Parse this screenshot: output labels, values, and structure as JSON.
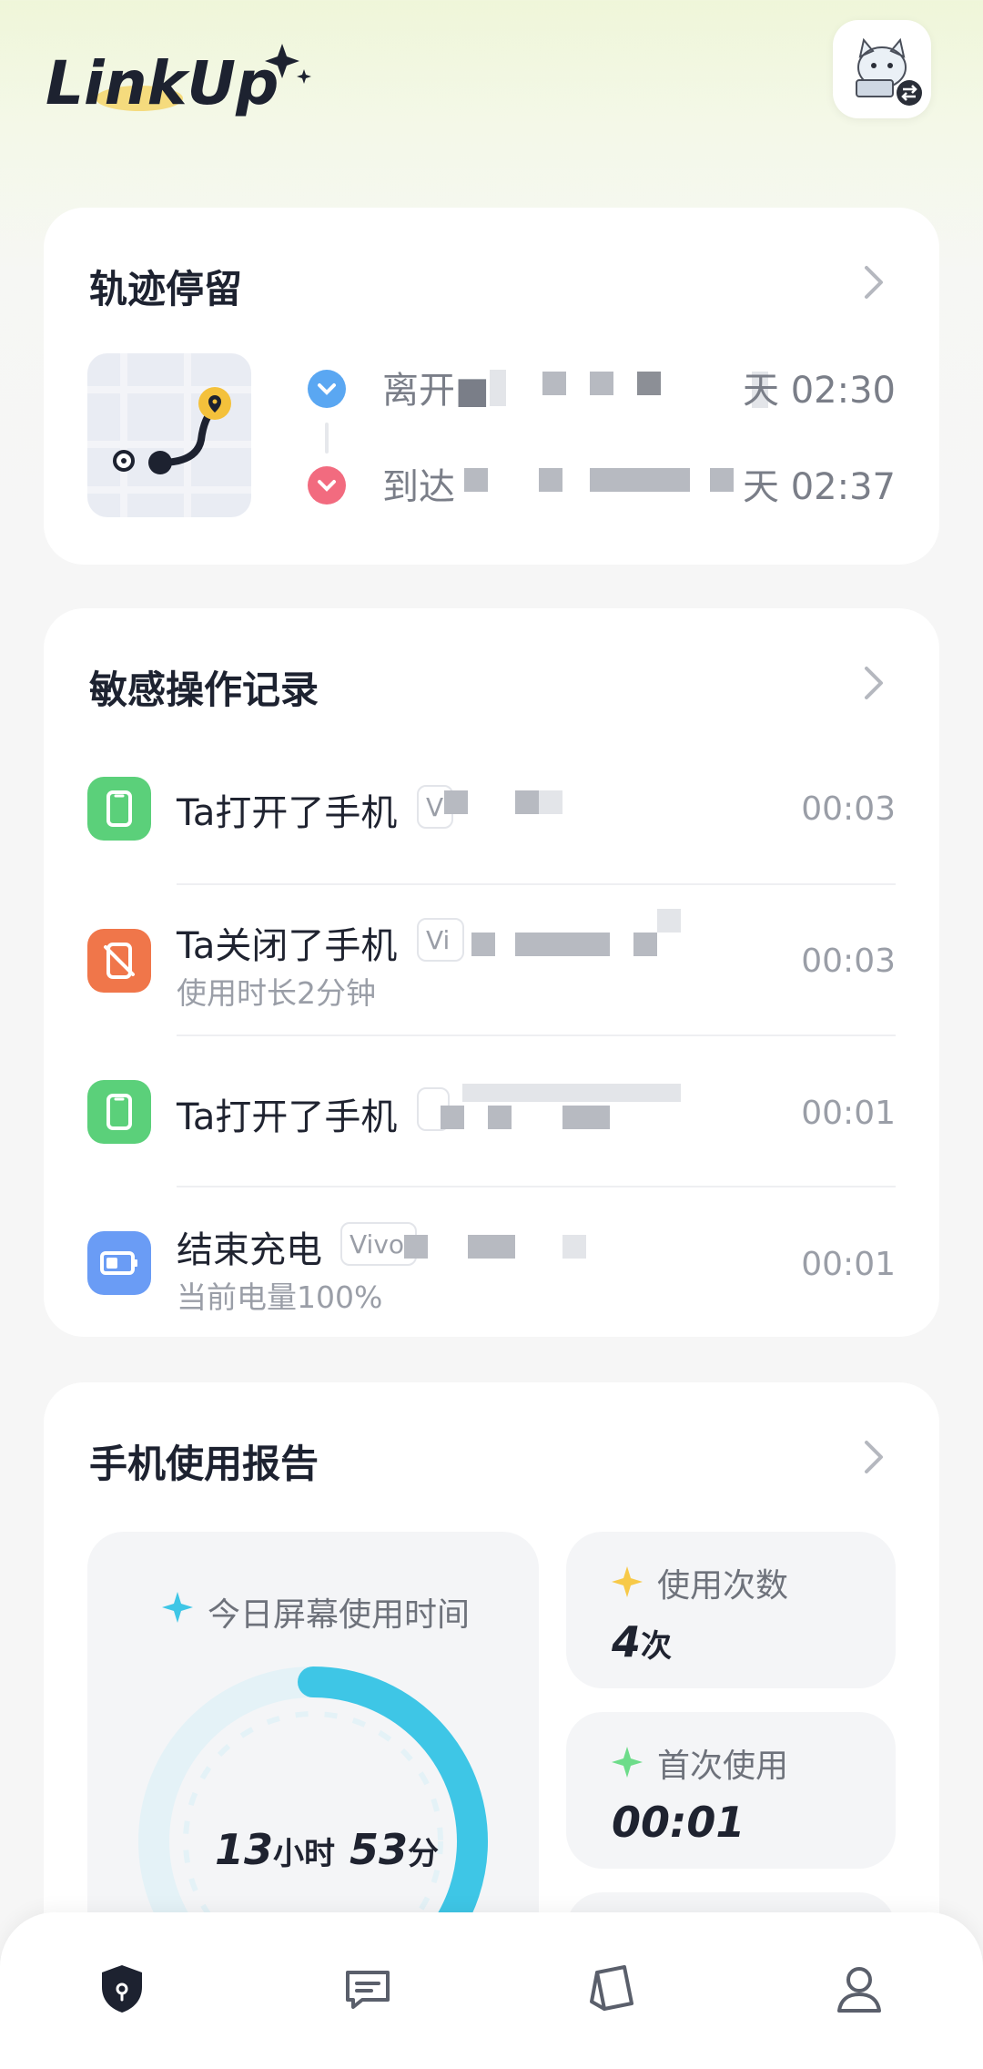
{
  "app": {
    "logo_text": "LinkUp"
  },
  "track_card": {
    "title": "轨迹停留",
    "entries": [
      {
        "text": "离开■",
        "time": "天 02:30",
        "color": "#5aa7f2"
      },
      {
        "text": "到达",
        "time": "天 02:37",
        "color": "#f26b7f"
      }
    ]
  },
  "sensitive_card": {
    "title": "敏感操作记录",
    "rows": [
      {
        "title": "Ta打开了手机",
        "tag": "V",
        "sub": "",
        "time": "00:03",
        "icon": "phone-icon",
        "icon_color": "#5bd07a"
      },
      {
        "title": "Ta关闭了手机",
        "tag": "Vi",
        "sub": "使用时长2分钟",
        "time": "00:03",
        "icon": "phone-off-icon",
        "icon_color": "#f0764a"
      },
      {
        "title": "Ta打开了手机",
        "tag": "",
        "sub": "",
        "time": "00:01",
        "icon": "phone-icon",
        "icon_color": "#5bd07a"
      },
      {
        "title": "结束充电",
        "tag": "Vivo",
        "sub": "当前电量100%",
        "time": "00:01",
        "icon": "battery-icon",
        "icon_color": "#6a9cf5"
      }
    ]
  },
  "report_card": {
    "title": "手机使用报告",
    "screen_time_label": "今日屏幕使用时间",
    "screen_time_hours": "13",
    "screen_time_hours_unit": "小时",
    "screen_time_minutes": "53",
    "screen_time_minutes_unit": "分",
    "usage_count_label": "使用次数",
    "usage_count_value": "4",
    "usage_count_unit": "次",
    "first_use_label": "首次使用",
    "first_use_value": "00:01"
  },
  "colors": {
    "accent_cyan": "#3ec6e6",
    "star_yellow": "#f7c948",
    "star_green": "#6ddc8a"
  },
  "nav": [
    "shield-icon",
    "message-icon",
    "notebook-icon",
    "profile-icon"
  ]
}
